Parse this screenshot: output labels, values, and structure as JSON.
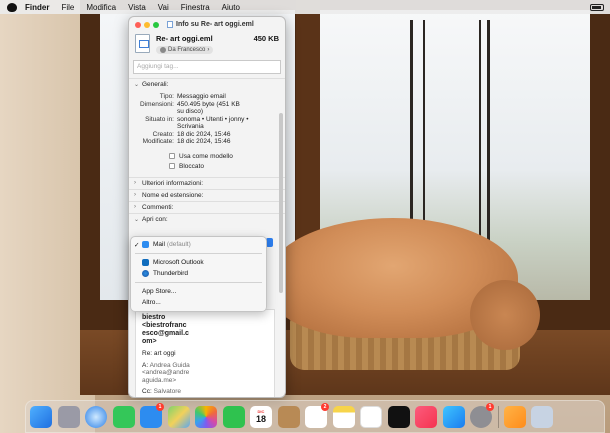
{
  "menubar": {
    "items": [
      {
        "label": "Finder",
        "bold": true
      },
      {
        "label": "File"
      },
      {
        "label": "Modifica"
      },
      {
        "label": "Vista"
      },
      {
        "label": "Vai"
      },
      {
        "label": "Finestra"
      },
      {
        "label": "Aiuto"
      }
    ]
  },
  "info_window": {
    "title": "Info su Re- art oggi.eml",
    "file_name": "Re- art oggi.eml",
    "file_size": "450 KB",
    "sender_chip": "Da Francesco",
    "tags_placeholder": "Aggiungi tag...",
    "sections": {
      "general": "Generali:",
      "more_info": "Ulteriori informazioni:",
      "name_ext": "Nome ed estensione:",
      "comments": "Commenti:",
      "open_with": "Apri con:"
    },
    "general": {
      "type_label": "Tipo:",
      "type_value": "Messaggio email",
      "size_label": "Dimensioni:",
      "size_value_1": "450.495 byte (451 KB",
      "size_value_2": "su disco)",
      "where_label": "Situato in:",
      "where_value_1": "sonoma • Utenti • jonny •",
      "where_value_2": "Scrivania",
      "created_label": "Creato:",
      "created_value": "18 dic 2024, 15:46",
      "modified_label": "Modificate:",
      "modified_value": "18 dic 2024, 15:46",
      "stationery_label": "Usa come modello",
      "locked_label": "Bloccato"
    },
    "preview": {
      "line1": "biestro",
      "line2": "<biestrofranc",
      "line3": "esco@gmail.c",
      "line4": "om>",
      "subject": "Re: art oggi",
      "to_label": "A:",
      "to_name": "Andrea Guida",
      "to_email_1": "<andrea@andre",
      "to_email_2": "aguida.me>",
      "cc_label": "Cc:",
      "cc_name": "Salvatore"
    }
  },
  "open_with_menu": {
    "mail": "Mail",
    "mail_default": "(default)",
    "outlook": "Microsoft Outlook",
    "thunderbird": "Thunderbird",
    "app_store": "App Store...",
    "other": "Altro..."
  },
  "dock": {
    "calendar_month": "DIC",
    "calendar_day": "18",
    "mail_badge": "1",
    "reminders_badge": "2",
    "settings_badge": "1"
  }
}
